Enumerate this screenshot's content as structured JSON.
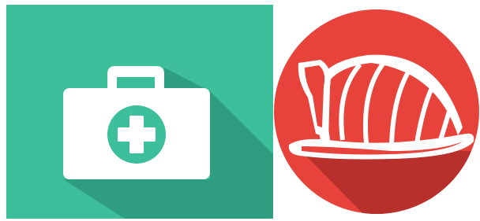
{
  "icons": [
    {
      "name": "medical-kit-icon",
      "background_color": "#3dbf9b",
      "shadow_color": "#2f9e80",
      "foreground_color": "#ffffff",
      "accent_color": "#3dbf9b"
    },
    {
      "name": "firefighter-helmet-icon",
      "background_color": "#e8433b",
      "shadow_color": "#b8302b",
      "foreground_color": "#ffffff",
      "accent_color": "#e8433b"
    }
  ]
}
